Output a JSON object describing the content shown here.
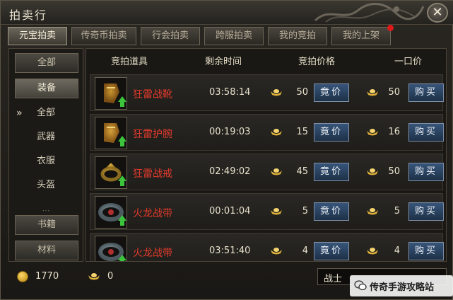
{
  "window": {
    "title": "拍卖行"
  },
  "tabs": [
    {
      "label": "元宝拍卖",
      "active": true
    },
    {
      "label": "传奇币拍卖",
      "active": false
    },
    {
      "label": "行会拍卖",
      "active": false
    },
    {
      "label": "跨服拍卖",
      "active": false
    },
    {
      "label": "我的竞拍",
      "active": false
    },
    {
      "label": "我的上架",
      "active": false,
      "notification": true
    }
  ],
  "sidebar": {
    "all_label": "全部",
    "equipment_label": "装备",
    "sub_items": [
      "全部",
      "武器",
      "衣服",
      "头盔"
    ],
    "selected_sub": "全部",
    "books_label": "书籍",
    "materials_label": "材料"
  },
  "table": {
    "columns": [
      "竞拍道具",
      "剩余时间",
      "竞拍价格",
      "一口价"
    ],
    "bid_button_label": "竟价",
    "buy_button_label": "购买",
    "rows": [
      {
        "item": "狂雷战靴",
        "time": "03:58:14",
        "bid_price": "50",
        "buyout": "50",
        "icon": "boots-icon"
      },
      {
        "item": "狂雷护腕",
        "time": "00:19:03",
        "bid_price": "15",
        "buyout": "16",
        "icon": "bracer-icon"
      },
      {
        "item": "狂雷战戒",
        "time": "02:49:02",
        "bid_price": "45",
        "buyout": "50",
        "icon": "ring-icon"
      },
      {
        "item": "火龙战带",
        "time": "00:01:04",
        "bid_price": "5",
        "buyout": "5",
        "icon": "belt-icon"
      },
      {
        "item": "火龙战带",
        "time": "03:51:40",
        "bid_price": "4",
        "buyout": "4",
        "icon": "belt-icon"
      }
    ]
  },
  "currency": {
    "gold": "1770",
    "yuanbao": "0"
  },
  "filter": {
    "class_label": "战士"
  },
  "watermark": {
    "text": "传奇手游攻略站"
  },
  "colors": {
    "item_name": "#e43a2c",
    "button_blue": "#2c4868",
    "upgrade_arrow": "#3cc43c"
  }
}
